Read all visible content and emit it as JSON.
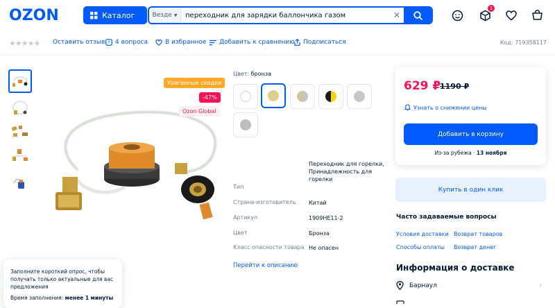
{
  "header": {
    "logo": "OZON",
    "catalog_label": "Каталог",
    "search_scope": "Везде",
    "search_value": "переходник для зарядки баллончика газом",
    "cart_badge": "1"
  },
  "actions": {
    "review": "Оставить отзыв",
    "questions": "4 вопроса",
    "favorites": "В избранное",
    "compare": "Добавить к сравнению",
    "subscribe": "Подписаться",
    "code": "Код: 719358117"
  },
  "tags": {
    "sale": "Ураганные скидки",
    "discount": "-47%",
    "global": "Ozon Global"
  },
  "color": {
    "label": "Цвет:",
    "value": "бронза",
    "swatches": [
      "#ffffff",
      "#dfcf8f",
      "#d3c594",
      "#1a1a1a",
      "#c8c8c8",
      "#bdbdbd"
    ]
  },
  "specs": [
    {
      "key": "Тип",
      "value": "Переходник для горелки, Принадлежность для горелки"
    },
    {
      "key": "Страна-изготовитель",
      "value": "Китай"
    },
    {
      "key": "Артикул",
      "value": "1909HE11-2"
    },
    {
      "key": "Цвет",
      "value": "Бронза"
    },
    {
      "key": "Класс опасности товара",
      "value": "Не опасен"
    }
  ],
  "desc_link": "Перейти к описанию",
  "buy": {
    "price": "629 ₽",
    "old_price": "1190 ₽",
    "notify": "Узнать о снижении цены",
    "cart_button": "Добавить в корзину",
    "delivery_prefix": "Из-за рубежа ·",
    "delivery_date": "13 ноября",
    "one_click": "Купить в один клик"
  },
  "faq": {
    "title": "Часто задаваемые вопросы",
    "links": [
      "Условия доставки",
      "Возврат товаров",
      "Способы оплаты",
      "Возврат денег"
    ]
  },
  "delivery": {
    "title": "Информация о доставке",
    "city": "Барнаул"
  },
  "survey": {
    "text": "Заполните короткий опрос, чтобы получать только актуальные для вас предложения",
    "time_prefix": "Время заполнения:",
    "time_value": "менее 1 минуты"
  },
  "colors": {
    "brand": "#005bff",
    "accent": "#f91155"
  }
}
